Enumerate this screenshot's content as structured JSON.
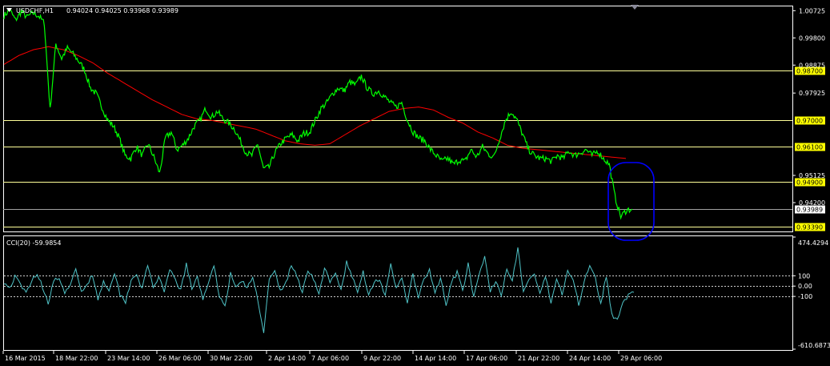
{
  "header": {
    "symbol": "USDCHF,H1",
    "ohlc": "0.94024 0.94025 0.93968 0.93989"
  },
  "indicator": {
    "name": "CCI(20) -59.9854"
  },
  "colors": {
    "background": "#000000",
    "price_line": "#00ff00",
    "ma_line": "#ff0000",
    "cci_line": "#4fc3c7",
    "level_line": "#ffff99",
    "level_box": "#ffff00",
    "current_price_line": "#a0a0a0",
    "annotation": "#0000ff",
    "axis": "#ffffff"
  },
  "chart_data": [
    {
      "type": "line",
      "title": "USDCHF,H1",
      "y_axis_ticks": [
        "1.00725",
        "0.99800",
        "0.98875",
        "0.97925",
        "0.95125",
        "0.94200"
      ],
      "x_axis_ticks": [
        "16 Mar 2015",
        "18 Mar 22:00",
        "23 Mar 14:00",
        "26 Mar 06:00",
        "30 Mar 22:00",
        "2 Apr 14:00",
        "7 Apr 06:00",
        "9 Apr 22:00",
        "14 Apr 14:00",
        "17 Apr 06:00",
        "21 Apr 22:00",
        "24 Apr 14:00",
        "29 Apr 06:00"
      ],
      "ylim": [
        0.9322,
        1.0087
      ],
      "horizontal_levels": [
        "0.98700",
        "0.97000",
        "0.96100",
        "0.94900",
        "0.93390"
      ],
      "current_price": "0.93989",
      "series": [
        {
          "values": [
            1.0055,
            1.0075,
            1.004,
            1.007,
            1.005,
            1.0065,
            1.0055,
            1.003,
            0.9735,
            0.996,
            0.991,
            0.9945,
            0.9925,
            0.99,
            0.987,
            0.981,
            0.979,
            0.9745,
            0.97,
            0.968,
            0.964,
            0.958,
            0.957,
            0.961,
            0.958,
            0.962,
            0.9575,
            0.952,
            0.964,
            0.966,
            0.96,
            0.9615,
            0.964,
            0.968,
            0.97,
            0.974,
            0.971,
            0.973,
            0.9705,
            0.969,
            0.967,
            0.963,
            0.959,
            0.958,
            0.962,
            0.9535,
            0.954,
            0.959,
            0.962,
            0.964,
            0.965,
            0.963,
            0.9655,
            0.966,
            0.97,
            0.974,
            0.976,
            0.979,
            0.981,
            0.98,
            0.983,
            0.982,
            0.985,
            0.981,
            0.979,
            0.98,
            0.978,
            0.976,
            0.9745,
            0.976,
            0.97,
            0.966,
            0.964,
            0.963,
            0.96,
            0.958,
            0.956,
            0.957,
            0.955,
            0.9565,
            0.956,
            0.96,
            0.9575,
            0.961,
            0.9585,
            0.9575,
            0.964,
            0.97,
            0.973,
            0.97,
            0.965,
            0.96,
            0.958,
            0.957,
            0.957,
            0.956,
            0.958,
            0.957,
            0.9595,
            0.958,
            0.959,
            0.96,
            0.958,
            0.9595,
            0.957,
            0.955,
            0.944,
            0.9372,
            0.9395,
            0.9398
          ]
        },
        {
          "values": [
            0.989,
            0.992,
            0.994,
            0.995,
            0.994,
            0.992,
            0.9895,
            0.986,
            0.983,
            0.98,
            0.977,
            0.9745,
            0.972,
            0.9705,
            0.97,
            0.969,
            0.968,
            0.967,
            0.965,
            0.963,
            0.962,
            0.9615,
            0.962,
            0.965,
            0.968,
            0.9705,
            0.973,
            0.974,
            0.9745,
            0.9735,
            0.971,
            0.969,
            0.966,
            0.964,
            0.9615,
            0.9605,
            0.96,
            0.9595,
            0.959,
            0.9585,
            0.958,
            0.9575,
            0.957
          ]
        }
      ]
    },
    {
      "type": "line",
      "title": "CCI(20) -59.9854",
      "y_axis_ticks": [
        "474.4294",
        "100",
        "0.00",
        "-100",
        "-610.6873"
      ],
      "ylim": [
        -610.6873,
        474.4294
      ],
      "horizontal_levels": [
        100,
        0,
        -100
      ],
      "series": [
        {
          "values": [
            40,
            -20,
            90,
            10,
            -70,
            60,
            120,
            -10,
            -160,
            50,
            80,
            -90,
            30,
            150,
            -60,
            20,
            110,
            -120,
            40,
            -30,
            130,
            -80,
            -150,
            60,
            120,
            -30,
            200,
            -10,
            90,
            -70,
            160,
            60,
            -40,
            210,
            -30,
            80,
            -120,
            40,
            180,
            -90,
            -200,
            120,
            -20,
            60,
            -30,
            90,
            -150,
            -440,
            60,
            140,
            -50,
            30,
            200,
            100,
            -60,
            160,
            80,
            -90,
            180,
            30,
            120,
            -40,
            230,
            90,
            -60,
            140,
            -80,
            40,
            70,
            -100,
            200,
            -30,
            90,
            -160,
            110,
            -110,
            60,
            150,
            -70,
            80,
            -200,
            40,
            130,
            -50,
            220,
            -120,
            100,
            280,
            -60,
            60,
            -80,
            180,
            40,
            380,
            -60,
            60,
            120,
            -90,
            90,
            -150,
            80,
            -70,
            160,
            70,
            -190,
            50,
            210,
            90,
            -170,
            100,
            -280,
            -320,
            -150,
            -90,
            -60
          ]
        }
      ]
    }
  ]
}
